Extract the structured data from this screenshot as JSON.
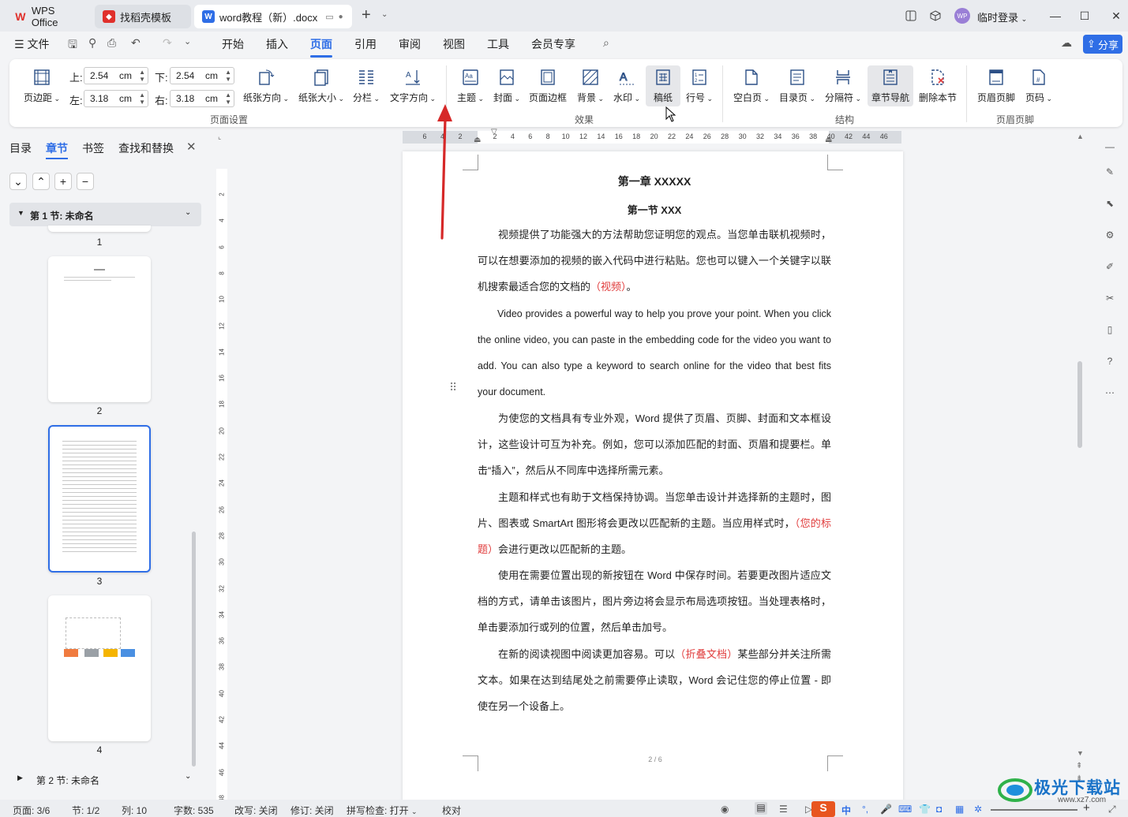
{
  "titlebar": {
    "tabs": [
      {
        "label": "WPS Office"
      },
      {
        "label": "找稻壳模板"
      },
      {
        "label": "word教程（新）.docx"
      }
    ],
    "new_tab": "+",
    "login": "临时登录",
    "avatar": "WP"
  },
  "menubar": {
    "file": "文件",
    "items": [
      "开始",
      "插入",
      "页面",
      "引用",
      "审阅",
      "视图",
      "工具",
      "会员专享"
    ],
    "active": "页面",
    "share": "分享"
  },
  "ribbon": {
    "margins": {
      "button": "页边距",
      "top_label": "上:",
      "top_value": "2.54",
      "bottom_label": "下:",
      "bottom_value": "2.54",
      "left_label": "左:",
      "left_value": "3.18",
      "right_label": "右:",
      "right_value": "3.18",
      "unit": "cm"
    },
    "page_setup": [
      "纸张方向",
      "纸张大小",
      "分栏",
      "文字方向"
    ],
    "effects": [
      "主题",
      "封面",
      "页面边框",
      "背景",
      "水印",
      "稿纸",
      "行号"
    ],
    "structure": [
      "空白页",
      "目录页",
      "分隔符",
      "章节导航",
      "删除本节"
    ],
    "header_footer": [
      "页眉页脚",
      "页码"
    ],
    "groups": [
      "页面设置",
      "效果",
      "结构",
      "页眉页脚"
    ]
  },
  "leftpanel": {
    "tabs": [
      "目录",
      "章节",
      "书签",
      "查找和替换"
    ],
    "active_tab": "章节",
    "section1": "第 1 节: 未命名",
    "section2": "第 2 节: 未命名",
    "page_numbers": [
      "1",
      "2",
      "3",
      "4"
    ]
  },
  "ruler": {
    "h_ticks": [
      "6",
      "4",
      "2",
      "2",
      "4",
      "6",
      "8",
      "10",
      "12",
      "14",
      "16",
      "18",
      "20",
      "22",
      "24",
      "26",
      "28",
      "30",
      "32",
      "34",
      "36",
      "38",
      "40",
      "42",
      "44",
      "46"
    ],
    "v_ticks": [
      "2",
      "4",
      "6",
      "8",
      "10",
      "12",
      "14",
      "16",
      "18",
      "20",
      "22",
      "24",
      "26",
      "28",
      "30",
      "32",
      "34",
      "36",
      "38",
      "40",
      "42",
      "44",
      "46",
      "48"
    ]
  },
  "document": {
    "chapter_title": "第一章  XXXXX",
    "section_title": "第一节  XXX",
    "p1_a": "视频提供了功能强大的方法帮助您证明您的观点。当您单击联机视频时，可以在想要添加的视频的嵌入代码中进行粘贴。您也可以键入一个关键字以联机搜索最适合您的文档的",
    "p1_red": "（视频）",
    "p1_b": "。",
    "p2": "Video provides a powerful way to help you prove your point. When you click the online video, you can paste in the embedding code for the video you want to add. You can also type a keyword to search online for the video that best fits your document.",
    "p3": "为使您的文档具有专业外观，Word 提供了页眉、页脚、封面和文本框设计，这些设计可互为补充。例如，您可以添加匹配的封面、页眉和提要栏。单击“插入”，然后从不同库中选择所需元素。",
    "p4_a": "主题和样式也有助于文档保持协调。当您单击设计并选择新的主题时，图片、图表或 SmartArt 图形将会更改以匹配新的主题。当应用样式时，",
    "p4_red": "（您的标题）",
    "p4_b": "会进行更改以匹配新的主题。",
    "p5": "使用在需要位置出现的新按钮在 Word 中保存时间。若要更改图片适应文档的方式，请单击该图片，图片旁边将会显示布局选项按钮。当处理表格时，单击要添加行或列的位置，然后单击加号。",
    "p6_a": "在新的阅读视图中阅读更加容易。可以",
    "p6_red": "（折叠文档）",
    "p6_b": "某些部分并关注所需文本。如果在达到结尾处之前需要停止读取，Word 会记住您的停止位置 - 即使在另一个设备上。",
    "footer_page": "2 / 6"
  },
  "status": {
    "page": "页面: 3/6",
    "section": "节: 1/2",
    "column": "列: 10",
    "words": "字数: 535",
    "overwrite": "改写: 关闭",
    "revision": "修订: 关闭",
    "spellcheck": "拼写检查: 打开",
    "proof": "校对"
  },
  "watermark": {
    "brand": "极光下载站",
    "url": "www.xz7.com"
  },
  "colors": {
    "accent": "#2f6ee6",
    "red_text": "#e03b3b",
    "arrow": "#d62828"
  }
}
